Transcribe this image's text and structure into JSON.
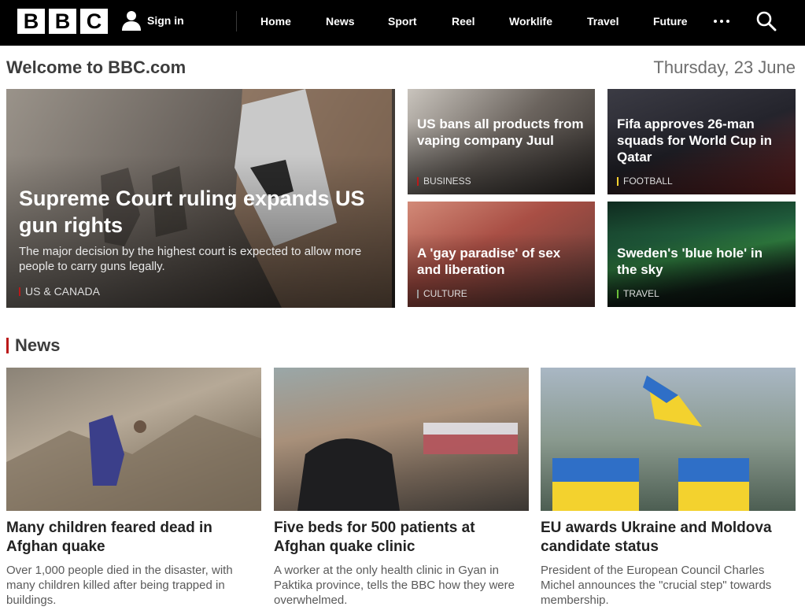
{
  "header": {
    "logo_letters": [
      "B",
      "B",
      "C"
    ],
    "sign_in_label": "Sign in",
    "nav_items": [
      "Home",
      "News",
      "Sport",
      "Reel",
      "Worklife",
      "Travel",
      "Future"
    ],
    "more_icon": "more-dots-icon",
    "search_icon": "search-icon"
  },
  "welcome": {
    "title": "Welcome to BBC.com",
    "date": "Thursday, 23 June"
  },
  "hero": {
    "main": {
      "title": "Supreme Court ruling expands US gun rights",
      "summary": "The major decision by the highest court is expected to allow more people to carry guns legally.",
      "tag": "US & CANADA",
      "tag_color": "#bb1919"
    },
    "juul": {
      "title": "US bans all products from vaping company Juul",
      "tag": "BUSINESS",
      "tag_color": "#bb1919"
    },
    "fifa": {
      "title": "Fifa approves 26-man squads for World Cup in Qatar",
      "tag": "FOOTBALL",
      "tag_color": "#ffd230"
    },
    "gay": {
      "title": "A 'gay paradise' of sex and liberation",
      "tag": "CULTURE",
      "tag_color": "#9a9a9a"
    },
    "sweden": {
      "title": "Sweden's 'blue hole' in the sky",
      "tag": "TRAVEL",
      "tag_color": "#6bbf3a"
    }
  },
  "news": {
    "section_label": "News",
    "accent": "#bb1919",
    "stories": [
      {
        "title": "Many children feared dead in Afghan quake",
        "summary": "Over 1,000 people died in the disaster, with many children killed after being trapped in buildings."
      },
      {
        "title": "Five beds for 500 patients at Afghan quake clinic",
        "summary": "A worker at the only health clinic in Gyan in Paktika province, tells the BBC how they were overwhelmed."
      },
      {
        "title": "EU awards Ukraine and Moldova candidate status",
        "summary": "President of the European Council Charles Michel announces the \"crucial step\" towards membership."
      }
    ]
  }
}
